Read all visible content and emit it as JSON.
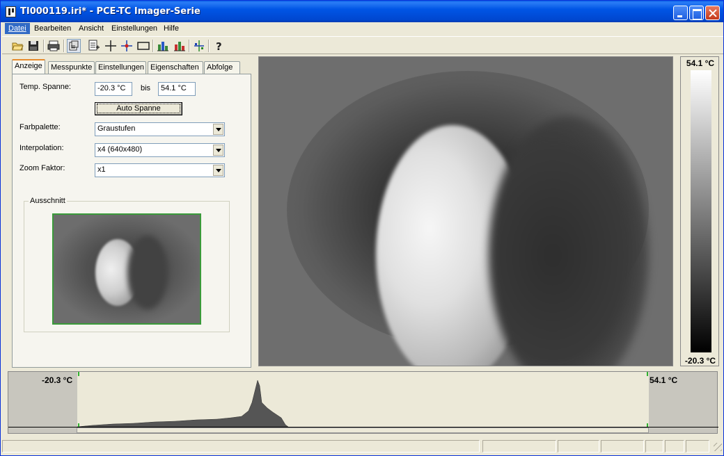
{
  "window": {
    "title": "TI000119.iri* - PCE-TC Imager-Serie"
  },
  "menubar": {
    "items": [
      {
        "label": "Datei"
      },
      {
        "label": "Bearbeiten"
      },
      {
        "label": "Ansicht"
      },
      {
        "label": "Einstellungen"
      },
      {
        "label": "Hilfe"
      }
    ]
  },
  "toolbar": {
    "icons": [
      "open-folder-icon",
      "save-icon",
      "print-icon",
      "properties-icon",
      "report-icon",
      "crosshair-icon",
      "measure-point-icon",
      "rectangle-icon",
      "histogram-icon",
      "histogram-color-icon",
      "marker-icon",
      "help-icon"
    ]
  },
  "tabs": [
    {
      "label": "Anzeige",
      "active": true
    },
    {
      "label": "Messpunkte"
    },
    {
      "label": "Einstellungen"
    },
    {
      "label": "Eigenschaften"
    },
    {
      "label": "Abfolge"
    }
  ],
  "anzeige": {
    "temp_span_label": "Temp. Spanne:",
    "temp_min": "-20.3 °C",
    "bis_label": "bis",
    "temp_max": "54.1 °C",
    "auto_button": "Auto Spanne",
    "palette_label": "Farbpalette:",
    "palette_value": "Graustufen",
    "interp_label": "Interpolation:",
    "interp_value": "x4 (640x480)",
    "zoom_label": "Zoom Faktor:",
    "zoom_value": "x1",
    "ausschnitt_label": "Ausschnitt"
  },
  "colorscale": {
    "max": "54.1 °C",
    "min": "-20.3 °C"
  },
  "histogram": {
    "min_label": "-20.3 °C",
    "max_label": "54.1 °C"
  },
  "colors": {
    "title_blue": "#0055e5",
    "menu_highlight": "#316ac5",
    "tab_accent": "#e68b2c",
    "frame_green": "#3a9a3a"
  }
}
